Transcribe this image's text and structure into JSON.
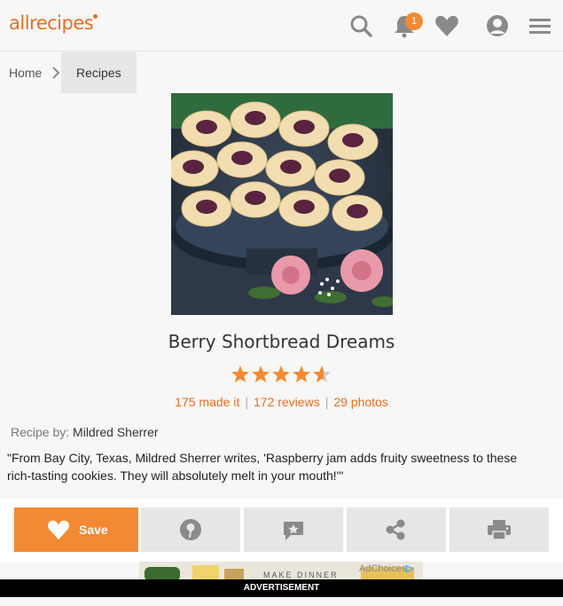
{
  "header": {
    "logo_text": "allrecipes",
    "notification_count": "1",
    "icons": [
      "search-icon",
      "bell-icon",
      "heart-icon",
      "user-icon",
      "menu-icon"
    ],
    "accent_color": "#e66e21"
  },
  "breadcrumb": {
    "home": "Home",
    "current": "Recipes"
  },
  "recipe": {
    "title": "Berry Shortbread Dreams",
    "rating": 4.6,
    "rating_max": 5,
    "made_it": "175 made it",
    "reviews": "172 reviews",
    "photos": "29 photos",
    "by_label": "Recipe by:",
    "author": "Mildred Sherrer",
    "description": "\"From Bay City, Texas, Mildred Sherrer writes, 'Raspberry jam adds fruity sweetness to these rich-tasting cookies. They will absolutely melt in your mouth!'\""
  },
  "actions": {
    "save_label": "Save",
    "icons": [
      "heart-icon",
      "pin-icon",
      "review-icon",
      "share-icon",
      "print-icon"
    ]
  },
  "ad": {
    "choices_label": "AdChoices",
    "banner_label": "ADVERTISEMENT",
    "banner_text": "MAKE DINNER"
  }
}
